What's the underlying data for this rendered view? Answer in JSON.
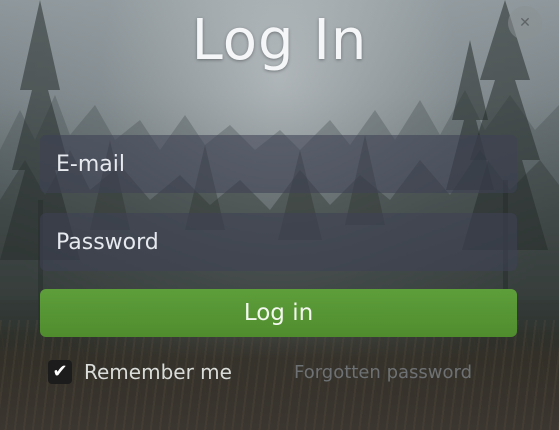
{
  "dialog": {
    "title": "Log In",
    "close_icon": "close-icon",
    "close_symbol": "✕"
  },
  "form": {
    "email": {
      "value": "",
      "placeholder": "E-mail"
    },
    "password": {
      "value": "",
      "placeholder": "Password"
    },
    "submit_label": "Log in",
    "remember_me": {
      "label": "Remember me",
      "checked": true,
      "check_symbol": "✔"
    },
    "forgot_link": "Forgotten password"
  },
  "colors": {
    "submit": "#4f8c2e",
    "field_background": "#3e4254",
    "title_text": "#f4f6f7"
  }
}
